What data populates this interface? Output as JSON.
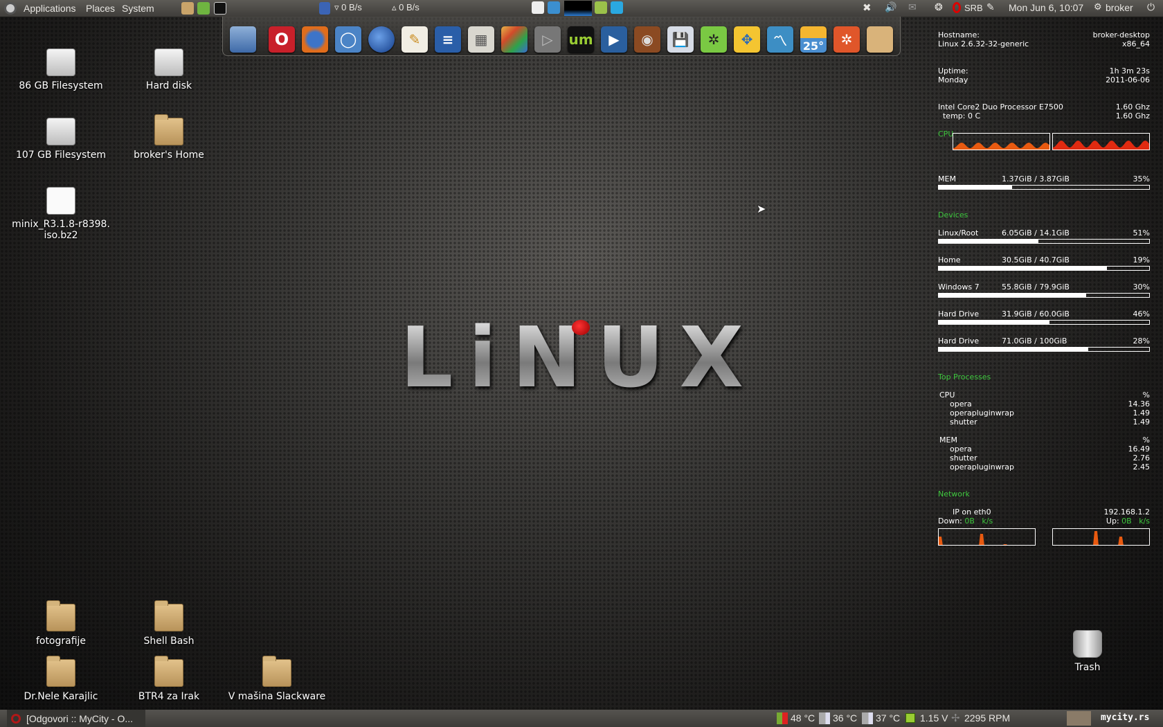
{
  "top_panel": {
    "menus": [
      "Applications",
      "Places",
      "System"
    ],
    "net_down": "0 B/s",
    "net_up": "0 B/s",
    "keyboard_layout": "SRB",
    "clock": "Mon Jun  6, 10:07",
    "user": "broker"
  },
  "dock": {
    "icons": [
      "workspace-switcher",
      "opera",
      "firefox",
      "chromium",
      "google-earth",
      "text-editor",
      "openoffice-writer",
      "calculator",
      "paint",
      "media-player",
      "umplayer",
      "video-player",
      "speaker",
      "floppy-save",
      "ubuntu-green",
      "vmware",
      "system-monitor",
      "weather",
      "ubuntu",
      "folder"
    ],
    "weather_temp": "25°"
  },
  "desktop": {
    "items": [
      {
        "label": "86 GB Filesystem",
        "icon": "drive"
      },
      {
        "label": "Hard disk",
        "icon": "drive"
      },
      {
        "label": "107 GB Filesystem",
        "icon": "drive"
      },
      {
        "label": "broker's Home",
        "icon": "home-folder"
      },
      {
        "label": "minix_R3.1.8-r8398.\niso.bz2",
        "icon": "archive"
      },
      {
        "label": "fotografije",
        "icon": "folder"
      },
      {
        "label": "Shell Bash",
        "icon": "folder"
      },
      {
        "label": "Dr.Nele Karajlic",
        "icon": "folder"
      },
      {
        "label": "BTR4 za Irak",
        "icon": "folder"
      },
      {
        "label": "V mašina Slackware",
        "icon": "folder"
      },
      {
        "label": "Trash",
        "icon": "trash"
      }
    ]
  },
  "conky": {
    "hostname_label": "Hostname:",
    "hostname": "broker-desktop",
    "kernel": "Linux 2.6.32-32-generic",
    "arch": "x86_64",
    "uptime_label": "Uptime:",
    "uptime": "1h 3m 23s",
    "day": "Monday",
    "date": "2011-06-06",
    "cpu_name": "Intel Core2 Duo Processor E7500",
    "freq1": "1.60 Ghz",
    "temp": "  temp: 0 C",
    "freq2": "1.60 Ghz",
    "cpu_label": "CPU",
    "mem": {
      "label": "MEM",
      "value": "1.37GiB / 3.87GiB",
      "pct": "35%",
      "fill": 0.35
    },
    "devices_title": "Devices",
    "devices": [
      {
        "label": "Linux/Root",
        "value": "6.05GiB / 14.1GiB",
        "pct": "51%",
        "fill": 0.475
      },
      {
        "label": "Home",
        "value": "30.5GiB / 40.7GiB",
        "pct": "19%",
        "fill": 0.8
      },
      {
        "label": "Windows 7",
        "value": "55.8GiB / 79.9GiB",
        "pct": "30%",
        "fill": 0.7
      },
      {
        "label": "Hard Drive",
        "value": "31.9GiB / 60.0GiB",
        "pct": "46%",
        "fill": 0.525
      },
      {
        "label": "Hard Drive",
        "value": "71.0GiB / 100GiB",
        "pct": "28%",
        "fill": 0.71
      }
    ],
    "top_title": "Top Processes",
    "top_cpu": {
      "header": "CPU",
      "pct": "%",
      "rows": [
        [
          "opera",
          "14.36"
        ],
        [
          "operapluginwrap",
          "1.49"
        ],
        [
          "shutter",
          "1.49"
        ]
      ]
    },
    "top_mem": {
      "header": "MEM",
      "pct": "%",
      "rows": [
        [
          "opera",
          "16.49"
        ],
        [
          "shutter",
          "2.76"
        ],
        [
          "operapluginwrap",
          "2.45"
        ]
      ]
    },
    "network_title": "Network",
    "ip_label": "IP on eth0",
    "ip": "192.168.1.2",
    "down_label": "Down:",
    "down": "0B   k/s",
    "up_label": "Up:",
    "up": "0B   k/s"
  },
  "bottom_panel": {
    "task": "[Odgovori :: MyCity - O...",
    "sensors": [
      "48 °C",
      "36 °C",
      "37 °C",
      "1.15 V",
      "2295 RPM"
    ],
    "brand": "mycity.rs"
  }
}
